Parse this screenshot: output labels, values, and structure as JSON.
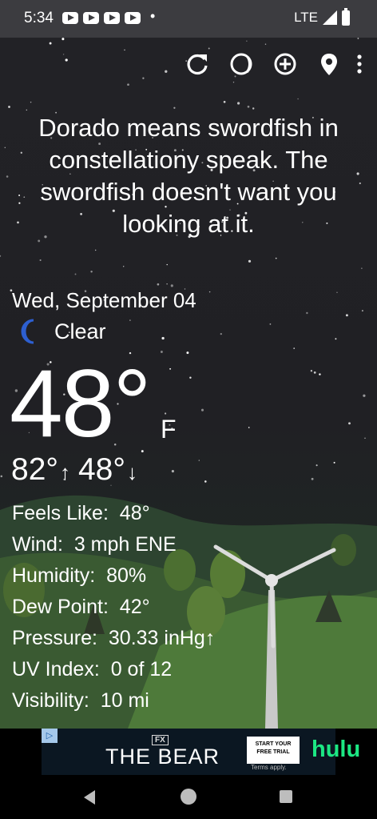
{
  "status_bar": {
    "time": "5:34",
    "notification_icons": [
      "youtube-icon",
      "youtube-icon",
      "youtube-icon",
      "youtube-icon"
    ],
    "dot": "•",
    "network": "LTE"
  },
  "toolbar": {
    "icons": [
      "refresh-icon",
      "theme-icon",
      "add-location-icon",
      "location-pin-icon",
      "more-vert-icon"
    ]
  },
  "fact": "Dorado means swordfish in constellationy speak. The swordfish doesn't want you looking at it.",
  "weather": {
    "date": "Wed, September 04",
    "condition_icon": "moon-icon",
    "condition": "Clear",
    "temperature": "48°",
    "unit": "F",
    "high": "82°",
    "low": "48°",
    "high_arrow": "↑",
    "low_arrow": "↓"
  },
  "details": [
    {
      "label": "Feels Like:",
      "value": "48°"
    },
    {
      "label": "Wind:",
      "value": "3 mph ENE"
    },
    {
      "label": "Humidity:",
      "value": "80%"
    },
    {
      "label": "Dew Point:",
      "value": "42°"
    },
    {
      "label": "Pressure:",
      "value": "30.33 inHg↑"
    },
    {
      "label": "UV Index:",
      "value": "0 of 12"
    },
    {
      "label": "Visibility:",
      "value": "10 mi"
    }
  ],
  "ad": {
    "info_icon": "ad-choices-icon",
    "network": "FX",
    "title": "THE BEAR",
    "cta_line1": "START YOUR",
    "cta_line2": "FREE TRIAL",
    "terms": "Terms apply.",
    "brand": "hulu",
    "brand_color": "#1ce783"
  },
  "nav": {
    "back_icon": "back-icon",
    "home_icon": "home-icon",
    "recents_icon": "recents-icon"
  }
}
